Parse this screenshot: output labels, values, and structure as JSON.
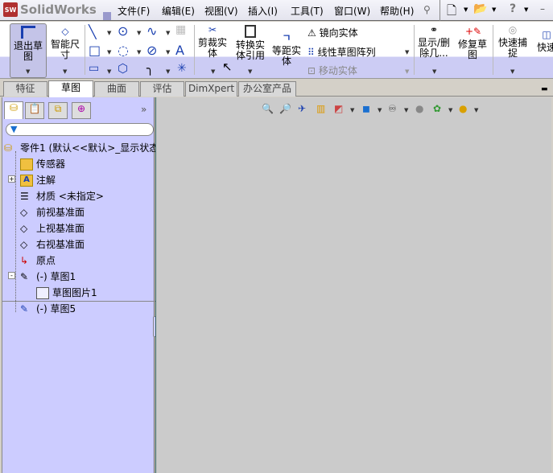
{
  "app": {
    "title": "SolidWorks"
  },
  "menu": [
    "文件(F)",
    "编辑(E)",
    "视图(V)",
    "插入(I)",
    "工具(T)",
    "窗口(W)",
    "帮助(H)"
  ],
  "ribbon": {
    "exit_sketch": "退出草图",
    "smart_dim": "智能尺寸",
    "trim": "剪裁实体",
    "convert": "转换实体引用",
    "offset": "等距实体",
    "mirror": "镜向实体",
    "linear_pattern": "线性草图阵列",
    "move": "移动实体",
    "show_delete": "显示/删除几...",
    "repair": "修复草图",
    "quick_snap": "快速捕捉",
    "quick_view": "快速"
  },
  "tabs": [
    {
      "label": "特征"
    },
    {
      "label": "草图",
      "active": true
    },
    {
      "label": "曲面"
    },
    {
      "label": "评估"
    },
    {
      "label": "DimXpert"
    },
    {
      "label": "办公室产品"
    }
  ],
  "panel": {
    "expand": "»",
    "filter_placeholder": ""
  },
  "tree": [
    {
      "label": "零件1  (默认<<默认>_显示状态",
      "icon": "part-icon"
    },
    {
      "label": "传感器",
      "icon": "sensor-folder-icon"
    },
    {
      "label": "注解",
      "icon": "annotation-folder-icon",
      "expander": "+"
    },
    {
      "label": "材质 <未指定>",
      "icon": "material-icon"
    },
    {
      "label": "前视基准面",
      "icon": "plane-icon"
    },
    {
      "label": "上视基准面",
      "icon": "plane-icon"
    },
    {
      "label": "右视基准面",
      "icon": "plane-icon"
    },
    {
      "label": "原点",
      "icon": "origin-icon"
    },
    {
      "label": "(-) 草图1",
      "icon": "sketch-icon",
      "expander": "-"
    },
    {
      "label": "草图图片1",
      "icon": "sketch-picture-icon"
    },
    {
      "label": "(-) 草图5",
      "icon": "sketch-edit-icon"
    }
  ],
  "colors": {
    "panel": "#ccccff",
    "viewport": "#cbcbcb",
    "ribbon_band": "#ccccf4"
  }
}
